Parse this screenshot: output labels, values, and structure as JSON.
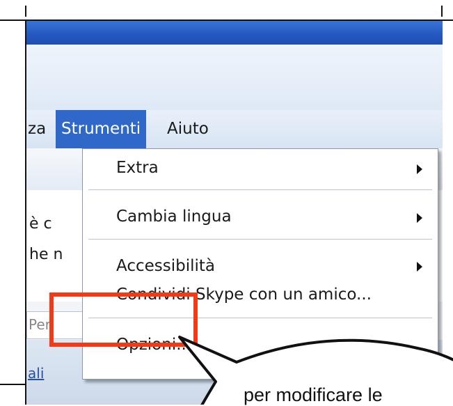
{
  "menubar": {
    "items": [
      {
        "label": "za"
      },
      {
        "label": "Strumenti"
      },
      {
        "label": "Aiuto"
      }
    ]
  },
  "background_text": {
    "line1": "è c",
    "line2": "he n",
    "search_placeholder": "Per",
    "bottom_link": "ali"
  },
  "dropdown": {
    "items": [
      {
        "label": "Extra",
        "submenu": true
      },
      {
        "label": "Cambia lingua",
        "submenu": true
      },
      {
        "label": "Accessibilità",
        "submenu": true
      },
      {
        "label": "Condividi Skype con un amico...",
        "submenu": false
      },
      {
        "label": "Opzioni...",
        "submenu": false
      }
    ]
  },
  "callout": {
    "text": "per modificare le"
  },
  "colors": {
    "menu_active": "#2f68c8",
    "highlight_box": "#f03a18",
    "titlebar": "#2458c0"
  }
}
